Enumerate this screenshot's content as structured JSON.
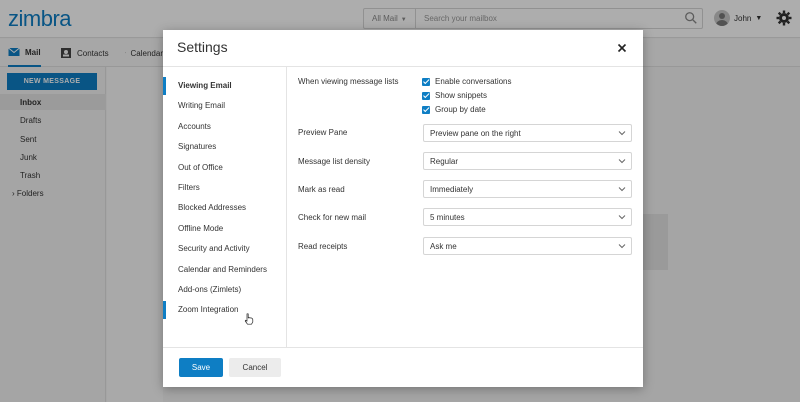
{
  "app": {
    "logo": "zimbra",
    "search": {
      "scope": "All Mail",
      "placeholder": "Search your mailbox"
    },
    "user": {
      "name": "John"
    },
    "nav": {
      "mail": "Mail",
      "contacts": "Contacts",
      "calendar": "Calendar"
    },
    "new_message": "NEW MESSAGE",
    "folders": [
      "Inbox",
      "Drafts",
      "Sent",
      "Junk",
      "Trash"
    ],
    "folders_group": "Folders"
  },
  "settings": {
    "title": "Settings",
    "menu": [
      "Viewing Email",
      "Writing Email",
      "Accounts",
      "Signatures",
      "Out of Office",
      "Filters",
      "Blocked Addresses",
      "Offline Mode",
      "Security and Activity",
      "Calendar and Reminders",
      "Add-ons (Zimlets)",
      "Zoom Integration"
    ],
    "viewing_label": "When viewing message lists",
    "checkboxes": [
      "Enable conversations",
      "Show snippets",
      "Group by date"
    ],
    "fields": [
      {
        "label": "Preview Pane",
        "value": "Preview pane on the right"
      },
      {
        "label": "Message list density",
        "value": "Regular"
      },
      {
        "label": "Mark as read",
        "value": "Immediately"
      },
      {
        "label": "Check for new mail",
        "value": "5 minutes"
      },
      {
        "label": "Read receipts",
        "value": "Ask me"
      }
    ],
    "save": "Save",
    "cancel": "Cancel"
  },
  "colors": {
    "accent": "#0e7ec4"
  }
}
